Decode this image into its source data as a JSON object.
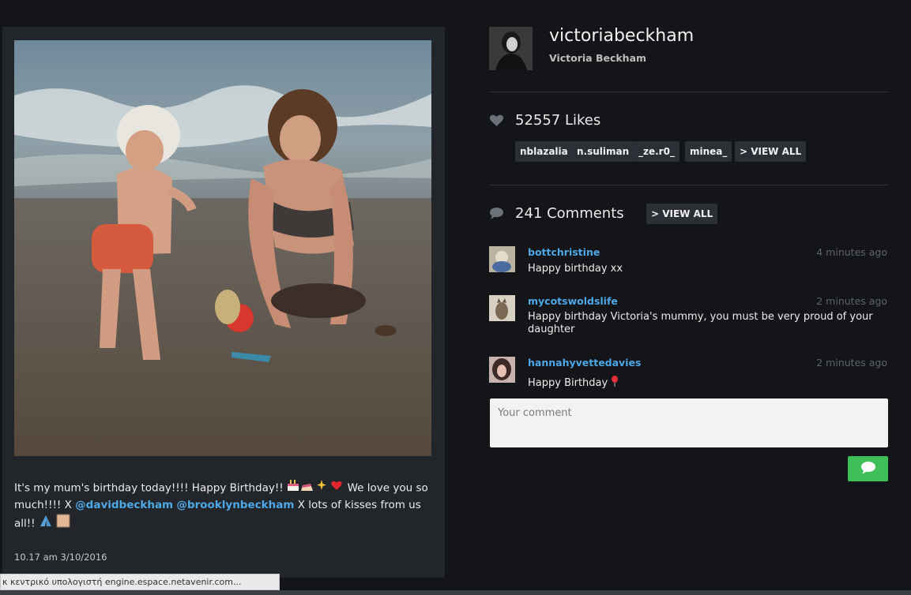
{
  "post": {
    "caption_part1": "It's my mum's birthday today!!!! Happy Birthday!!",
    "caption_part2": "We love you so much!!!! X",
    "mention1": "@davidbeckham",
    "mention2": "@brooklynbeckham",
    "caption_part3": "X lots of kisses from us all!!",
    "timestamp": "10.17 am 3/10/2016"
  },
  "profile": {
    "username": "victoriabeckham",
    "full_name": "Victoria Beckham"
  },
  "likes": {
    "label": "52557 Likes",
    "likers": [
      "nblazalia",
      "n.suliman",
      "_ze.r0_",
      "minea_"
    ],
    "view_all": "> VIEW ALL"
  },
  "comments": {
    "label": "241 Comments",
    "view_all": "> VIEW ALL",
    "items": [
      {
        "user": "bottchristine",
        "time": "4 minutes ago",
        "text": "Happy birthday xx"
      },
      {
        "user": "mycotswoldslife",
        "time": "2 minutes ago",
        "text": "Happy birthday Victoria's mummy, you must be very proud of your daughter"
      },
      {
        "user": "hannahyvettedavies",
        "time": "2 minutes ago",
        "text": "Happy Birthday"
      }
    ],
    "input_placeholder": "Your comment"
  },
  "status_bar": {
    "text": "κ κεντρικό υπολογιστή engine.espace.netavenir.com..."
  },
  "colors": {
    "background": "#131518",
    "card": "#22262b",
    "link": "#4ea7e6",
    "send_button": "#3fbf57"
  },
  "icons": [
    "heart-icon",
    "comment-bubble-icon",
    "send-chat-icon"
  ]
}
